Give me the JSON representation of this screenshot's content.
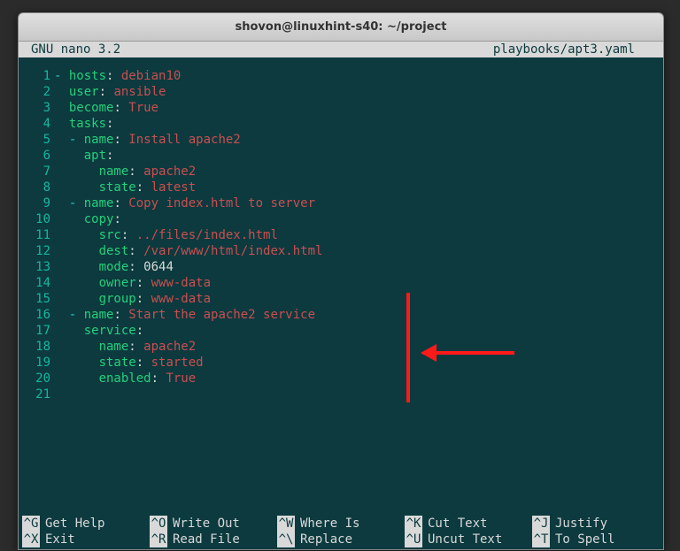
{
  "window": {
    "title": "shovon@linuxhint-s40: ~/project"
  },
  "nano": {
    "version": "GNU nano 3.2",
    "filename": "playbooks/apt3.yaml",
    "footer": [
      [
        {
          "key": "^G",
          "desc": "Get Help"
        },
        {
          "key": "^O",
          "desc": "Write Out"
        },
        {
          "key": "^W",
          "desc": "Where Is"
        },
        {
          "key": "^K",
          "desc": "Cut Text"
        },
        {
          "key": "^J",
          "desc": "Justify"
        }
      ],
      [
        {
          "key": "^X",
          "desc": "Exit"
        },
        {
          "key": "^R",
          "desc": "Read File"
        },
        {
          "key": "^\\",
          "desc": "Replace"
        },
        {
          "key": "^U",
          "desc": "Uncut Text"
        },
        {
          "key": "^T",
          "desc": "To Spell"
        }
      ]
    ]
  },
  "code_lines": [
    [
      {
        "c": "c-cyan",
        "t": "- "
      },
      {
        "c": "c-green",
        "t": "hosts"
      },
      {
        "c": "c-white",
        "t": ": "
      },
      {
        "c": "c-red",
        "t": "debian10"
      }
    ],
    [
      {
        "c": "c-white",
        "t": "  "
      },
      {
        "c": "c-green",
        "t": "user"
      },
      {
        "c": "c-white",
        "t": ": "
      },
      {
        "c": "c-red",
        "t": "ansible"
      }
    ],
    [
      {
        "c": "c-white",
        "t": "  "
      },
      {
        "c": "c-green",
        "t": "become"
      },
      {
        "c": "c-white",
        "t": ": "
      },
      {
        "c": "c-red",
        "t": "True"
      }
    ],
    [
      {
        "c": "c-white",
        "t": "  "
      },
      {
        "c": "c-green",
        "t": "tasks"
      },
      {
        "c": "c-white",
        "t": ":"
      }
    ],
    [
      {
        "c": "c-white",
        "t": "  "
      },
      {
        "c": "c-cyan",
        "t": "- "
      },
      {
        "c": "c-green",
        "t": "name"
      },
      {
        "c": "c-white",
        "t": ": "
      },
      {
        "c": "c-red",
        "t": "Install apache2"
      }
    ],
    [
      {
        "c": "c-white",
        "t": "    "
      },
      {
        "c": "c-green",
        "t": "apt"
      },
      {
        "c": "c-white",
        "t": ":"
      }
    ],
    [
      {
        "c": "c-white",
        "t": "      "
      },
      {
        "c": "c-green",
        "t": "name"
      },
      {
        "c": "c-white",
        "t": ": "
      },
      {
        "c": "c-red",
        "t": "apache2"
      }
    ],
    [
      {
        "c": "c-white",
        "t": "      "
      },
      {
        "c": "c-green",
        "t": "state"
      },
      {
        "c": "c-white",
        "t": ": "
      },
      {
        "c": "c-red",
        "t": "latest"
      }
    ],
    [
      {
        "c": "c-white",
        "t": "  "
      },
      {
        "c": "c-cyan",
        "t": "- "
      },
      {
        "c": "c-green",
        "t": "name"
      },
      {
        "c": "c-white",
        "t": ": "
      },
      {
        "c": "c-red",
        "t": "Copy index.html to server"
      }
    ],
    [
      {
        "c": "c-white",
        "t": "    "
      },
      {
        "c": "c-green",
        "t": "copy"
      },
      {
        "c": "c-white",
        "t": ":"
      }
    ],
    [
      {
        "c": "c-white",
        "t": "      "
      },
      {
        "c": "c-green",
        "t": "src"
      },
      {
        "c": "c-white",
        "t": ": "
      },
      {
        "c": "c-red",
        "t": "../files/index.html"
      }
    ],
    [
      {
        "c": "c-white",
        "t": "      "
      },
      {
        "c": "c-green",
        "t": "dest"
      },
      {
        "c": "c-white",
        "t": ": "
      },
      {
        "c": "c-red",
        "t": "/var/www/html/index.html"
      }
    ],
    [
      {
        "c": "c-white",
        "t": "      "
      },
      {
        "c": "c-green",
        "t": "mode"
      },
      {
        "c": "c-white",
        "t": ": 0644"
      }
    ],
    [
      {
        "c": "c-white",
        "t": "      "
      },
      {
        "c": "c-green",
        "t": "owner"
      },
      {
        "c": "c-white",
        "t": ": "
      },
      {
        "c": "c-red",
        "t": "www-data"
      }
    ],
    [
      {
        "c": "c-white",
        "t": "      "
      },
      {
        "c": "c-green",
        "t": "group"
      },
      {
        "c": "c-white",
        "t": ": "
      },
      {
        "c": "c-red",
        "t": "www-data"
      }
    ],
    [
      {
        "c": "c-white",
        "t": "  "
      },
      {
        "c": "c-cyan",
        "t": "- "
      },
      {
        "c": "c-green",
        "t": "name"
      },
      {
        "c": "c-white",
        "t": ": "
      },
      {
        "c": "c-red",
        "t": "Start the apache2 service"
      }
    ],
    [
      {
        "c": "c-white",
        "t": "    "
      },
      {
        "c": "c-green",
        "t": "service"
      },
      {
        "c": "c-white",
        "t": ":"
      }
    ],
    [
      {
        "c": "c-white",
        "t": "      "
      },
      {
        "c": "c-green",
        "t": "name"
      },
      {
        "c": "c-white",
        "t": ": "
      },
      {
        "c": "c-red",
        "t": "apache2"
      }
    ],
    [
      {
        "c": "c-white",
        "t": "      "
      },
      {
        "c": "c-green",
        "t": "state"
      },
      {
        "c": "c-white",
        "t": ": "
      },
      {
        "c": "c-red",
        "t": "started"
      }
    ],
    [
      {
        "c": "c-white",
        "t": "      "
      },
      {
        "c": "c-green",
        "t": "enabled"
      },
      {
        "c": "c-white",
        "t": ": "
      },
      {
        "c": "c-red",
        "t": "True"
      }
    ],
    []
  ]
}
